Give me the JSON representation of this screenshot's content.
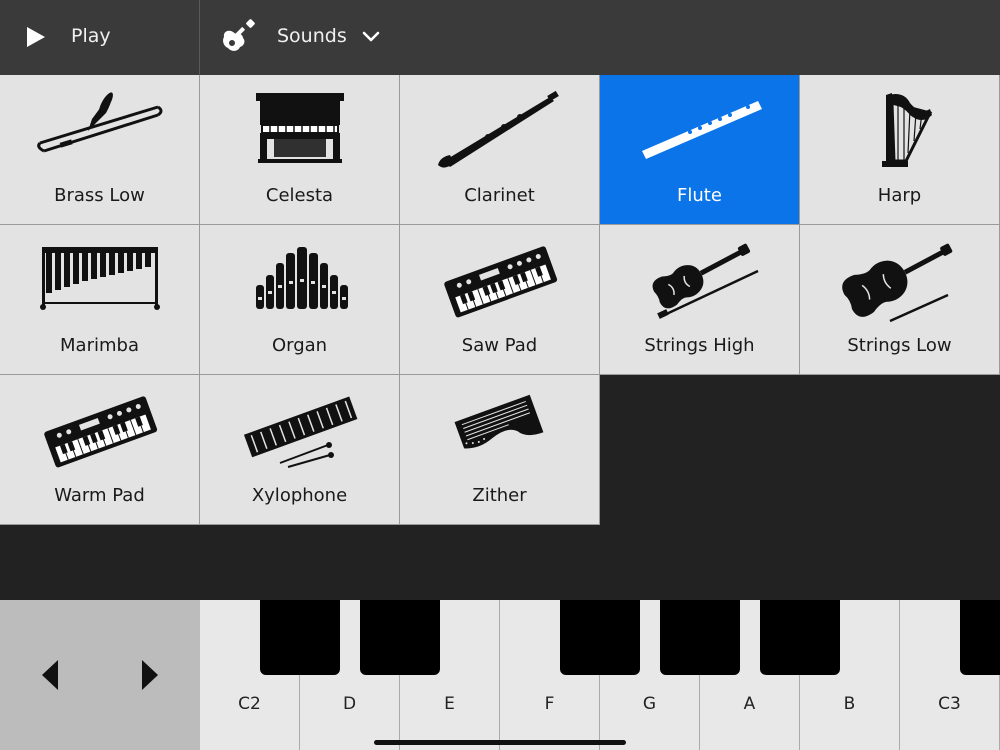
{
  "toolbar": {
    "play_label": "Play",
    "sounds_label": "Sounds"
  },
  "instruments": [
    {
      "name": "Brass Low",
      "icon": "trombone-icon",
      "selected": false
    },
    {
      "name": "Celesta",
      "icon": "celesta-icon",
      "selected": false
    },
    {
      "name": "Clarinet",
      "icon": "clarinet-icon",
      "selected": false
    },
    {
      "name": "Flute",
      "icon": "flute-icon",
      "selected": true
    },
    {
      "name": "Harp",
      "icon": "harp-icon",
      "selected": false
    },
    {
      "name": "Marimba",
      "icon": "marimba-icon",
      "selected": false
    },
    {
      "name": "Organ",
      "icon": "organ-icon",
      "selected": false
    },
    {
      "name": "Saw Pad",
      "icon": "synth-keyboard-icon",
      "selected": false
    },
    {
      "name": "Strings High",
      "icon": "violin-icon",
      "selected": false
    },
    {
      "name": "Strings Low",
      "icon": "cello-icon",
      "selected": false
    },
    {
      "name": "Warm Pad",
      "icon": "synth-keyboard-icon",
      "selected": false
    },
    {
      "name": "Xylophone",
      "icon": "xylophone-icon",
      "selected": false
    },
    {
      "name": "Zither",
      "icon": "zither-icon",
      "selected": false
    }
  ],
  "keyboard": {
    "white_keys": [
      "C2",
      "D",
      "E",
      "F",
      "G",
      "A",
      "B",
      "C3"
    ]
  },
  "colors": {
    "selected": "#0a74e8",
    "tile": "#e3e3e3",
    "toolbar": "#3a3a3a"
  }
}
